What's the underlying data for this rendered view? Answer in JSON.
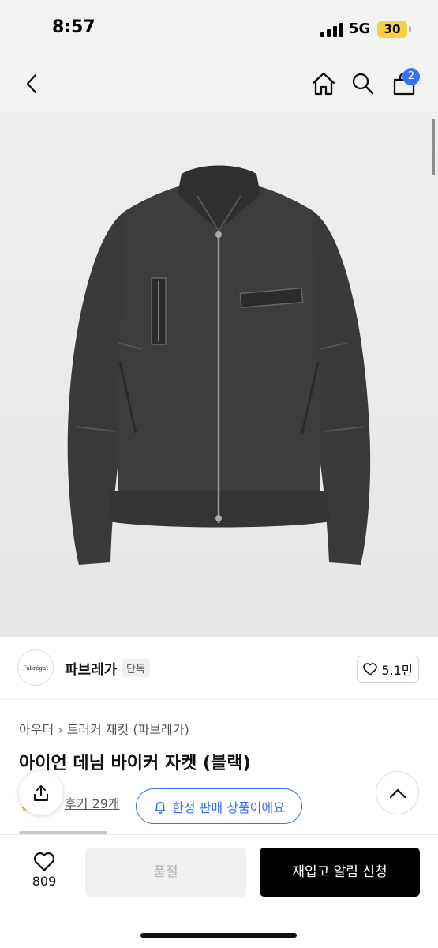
{
  "status_bar": {
    "time": "8:57",
    "network": "5G",
    "battery": "30"
  },
  "nav": {
    "cart_count": "2"
  },
  "brand": {
    "logo_text": "Fabrégat",
    "name": "파브레가",
    "badge": "단독",
    "likes": "5.1만"
  },
  "breadcrumb": {
    "category": "아우터",
    "subcategory": "트러커 재킷 (파브레가)"
  },
  "product": {
    "title": "아이언 데님 바이커 자켓 (블랙)",
    "reviews": "후기 29개",
    "limited_label": "한정 판매 상품이에요"
  },
  "bottom": {
    "wish_count": "809",
    "soldout_label": "품절",
    "restock_label": "재입고 알림 신청"
  },
  "colors": {
    "accent": "#3b6ef6",
    "battery": "#f4d443",
    "jacket": "#3a3a3a"
  }
}
